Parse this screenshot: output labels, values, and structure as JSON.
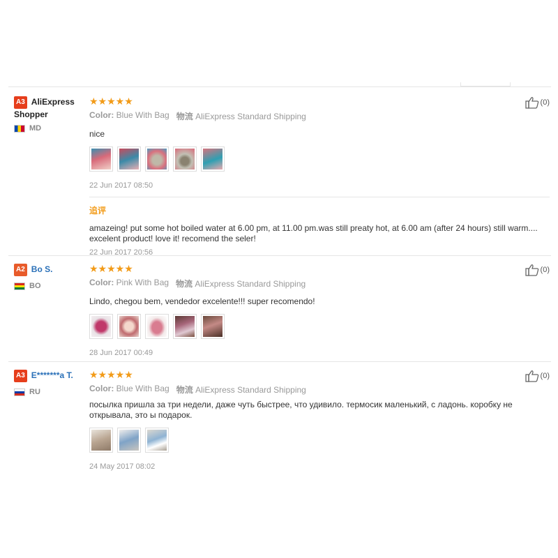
{
  "reviews": [
    {
      "badge": "A3",
      "user": "AliExpress Shopper",
      "country": "MD",
      "stars": "★★★★★",
      "color_label": "Color:",
      "color_value": "Blue With Bag",
      "shipping_label": "物流",
      "shipping_value": "AliExpress Standard Shipping",
      "text": "nice",
      "date": "22 Jun 2017 08:50",
      "likes": "(0)",
      "followup_label": "追评",
      "followup_text": "amazeing! put some hot boiled water at 6.00 pm, at 11.00 pm.was still preaty hot, at 6.00 am (after 24 hours) still warm.... excelent product! love it! recomend the seler!",
      "followup_date": "22 Jun 2017 20:56"
    },
    {
      "badge": "A2",
      "user": "Bo S.",
      "country": "BO",
      "stars": "★★★★★",
      "color_label": "Color:",
      "color_value": "Pink With Bag",
      "shipping_label": "物流",
      "shipping_value": "AliExpress Standard Shipping",
      "text": "Lindo, chegou bem, vendedor excelente!!! super recomendo!",
      "date": "28 Jun 2017 00:49",
      "likes": "(0)"
    },
    {
      "badge": "A3",
      "user": "E*******a T.",
      "country": "RU",
      "stars": "★★★★★",
      "color_label": "Color:",
      "color_value": "Blue With Bag",
      "shipping_label": "物流",
      "shipping_value": "AliExpress Standard Shipping",
      "text": "посылка пришла за три недели, даже чуть быстрее, что удивило. термосик маленький, с ладонь. коробку не открывала, это ы подарок.",
      "date": "24 May 2017 08:02",
      "likes": "(0)"
    }
  ],
  "colors": {
    "star": "#f29b18",
    "badge_a3": "#e63e1c",
    "link": "#2a70b8"
  },
  "icons": [
    "thumbs-up-icon",
    "country-flag-icon",
    "review-photo-thumbnail"
  ]
}
